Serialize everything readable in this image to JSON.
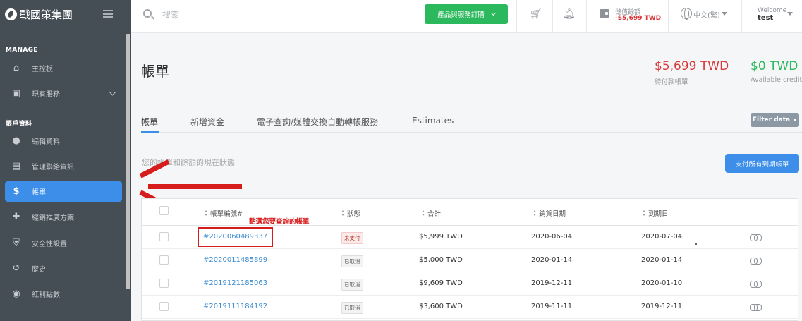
{
  "app": {
    "logo_text": "戰國策集團"
  },
  "sidebar": {
    "sections": [
      {
        "title": "MANAGE",
        "items": [
          {
            "label": "主控板",
            "icon": "home-icon"
          },
          {
            "label": "現有服務",
            "icon": "id-card-icon",
            "has_chevron": true
          }
        ]
      },
      {
        "title": "帳戶資料",
        "items": [
          {
            "label": "編輯資料",
            "icon": "user-icon"
          },
          {
            "label": "管理聯絡資訊",
            "icon": "contact-card-icon"
          },
          {
            "label": "帳單",
            "icon": "dollar-icon",
            "active": true
          },
          {
            "label": "經銷推廣方案",
            "icon": "users-plus-icon"
          },
          {
            "label": "安全性設置",
            "icon": "shield-icon"
          },
          {
            "label": "歷史",
            "icon": "history-icon"
          },
          {
            "label": "紅利點數",
            "icon": "points-icon"
          }
        ]
      }
    ]
  },
  "topbar": {
    "search_placeholder": "搜索",
    "order_button_label": "產品與服務訂購",
    "wallet_label": "儲值餘額",
    "wallet_value": "-$5,699 TWD",
    "language_label": "中文(繁)",
    "welcome_label": "Welcome",
    "username": "test"
  },
  "main": {
    "page_title": "帳單",
    "due_amount": "$5,699 TWD",
    "due_label": "待付款帳單",
    "credit_amount": "$0 TWD",
    "credit_label": "Available credit",
    "tabs": [
      {
        "label": "帳單",
        "active": true
      },
      {
        "label": "新增資金"
      },
      {
        "label": "電子查詢/媒體交換自動轉帳服務"
      },
      {
        "label": "Estimates"
      }
    ],
    "filter_label": "Filter data",
    "status_description": "您的帳單和餘額的現在狀態",
    "pay_all_label": "支付所有到期帳單",
    "annotation_text": "點選您要查詢的帳單"
  },
  "table": {
    "columns": [
      "帳單編號#",
      "狀態",
      "合計",
      "銷貨日期",
      "到期日"
    ],
    "rows": [
      {
        "invoice": "#2020060489337",
        "status": "未支付",
        "status_type": "unpaid",
        "total": "$5,999 TWD",
        "date": "2020-06-04",
        "due": "2020-07-04"
      },
      {
        "invoice": "#2020011485899",
        "status": "已取消",
        "status_type": "cancelled",
        "total": "$5,000 TWD",
        "date": "2020-01-14",
        "due": "2020-01-14"
      },
      {
        "invoice": "#2019121185063",
        "status": "已取消",
        "status_type": "cancelled",
        "total": "$9,609 TWD",
        "date": "2019-12-11",
        "due": "2020-01-10"
      },
      {
        "invoice": "#2019111184192",
        "status": "已取消",
        "status_type": "cancelled",
        "total": "$3,600 TWD",
        "date": "2019-11-11",
        "due": "2019-12-11"
      }
    ]
  },
  "colors": {
    "sidebar_bg": "#454d55",
    "accent_blue": "#3d8ee8",
    "order_green": "#2cb85c",
    "due_red": "#d9383a",
    "annotation_red": "#d71c1c"
  }
}
